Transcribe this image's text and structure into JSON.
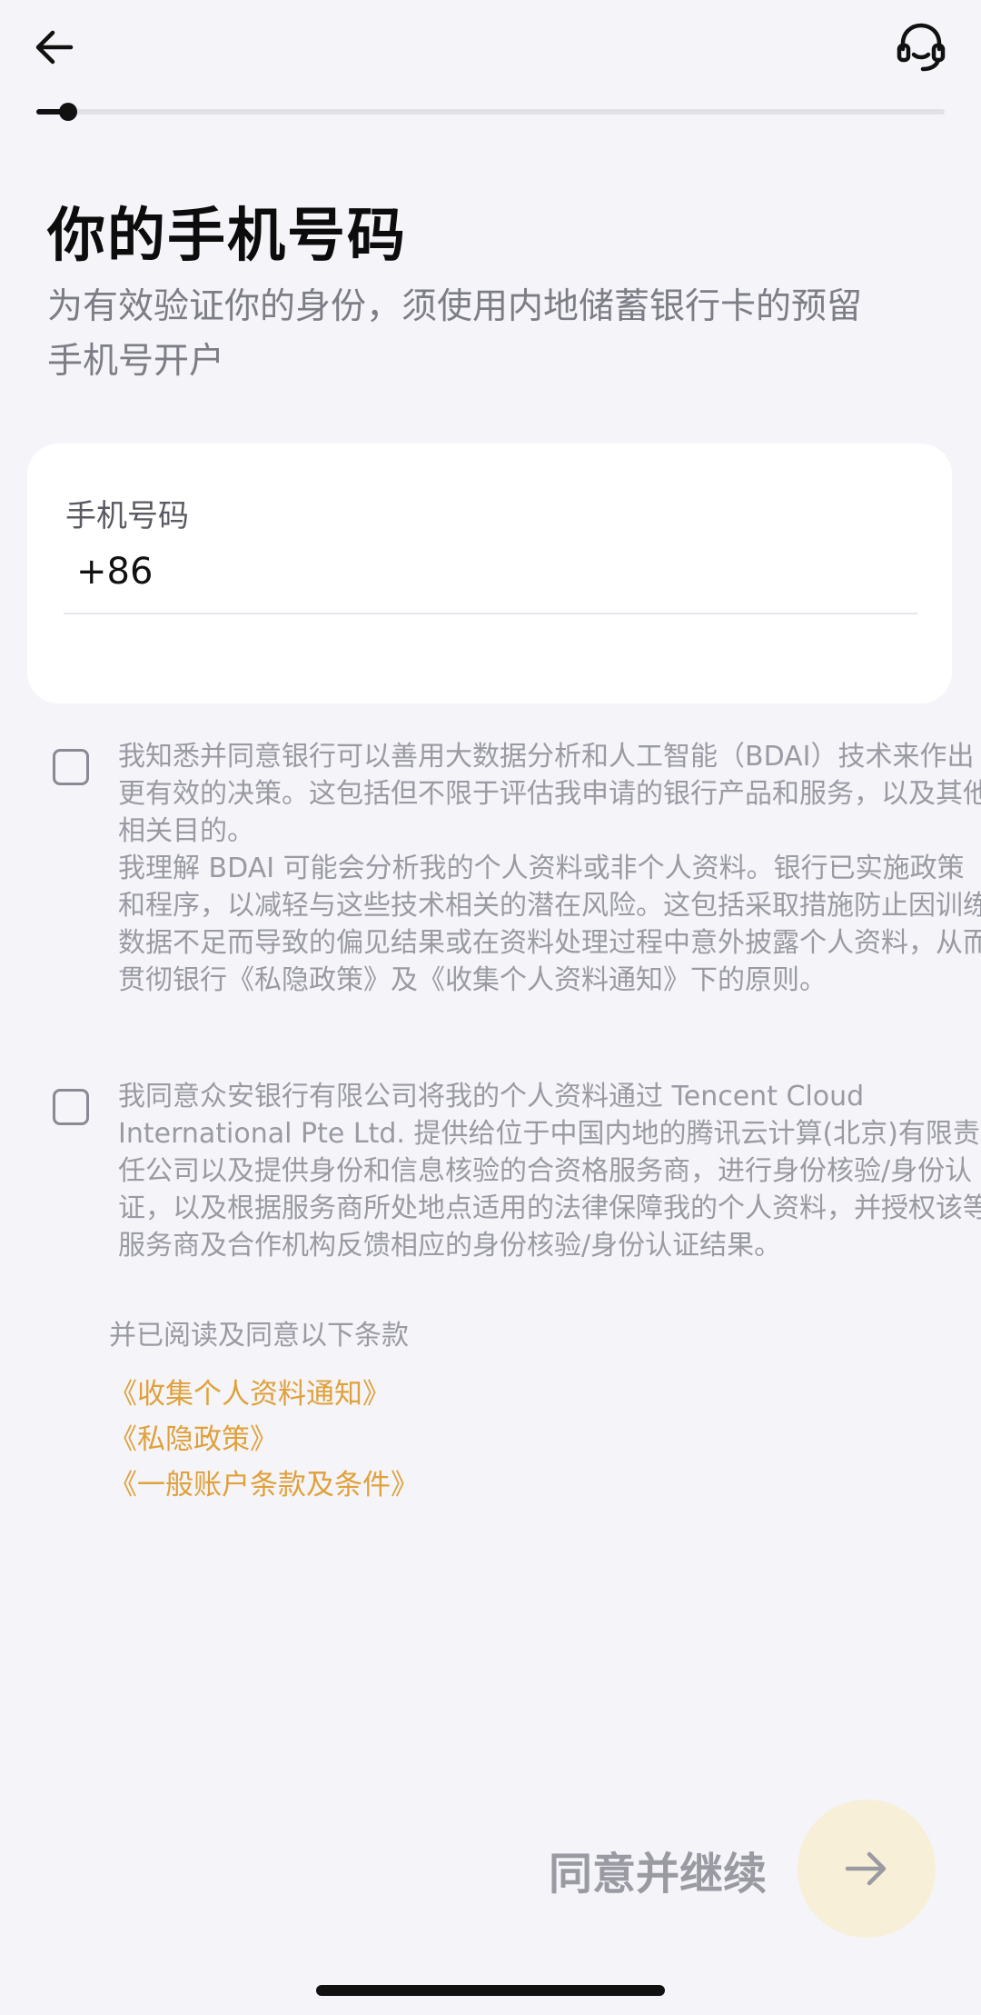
{
  "header": {
    "back_icon": "arrow-left-icon",
    "support_icon": "headset-icon"
  },
  "progress": {
    "fraction": 0.035
  },
  "title": "你的手机号码",
  "subtitle_line1": "为有效验证你的身份，须使用内地储蓄银行卡的预留",
  "subtitle_line2": "手机号开户",
  "phone": {
    "label": "手机号码",
    "country_code": "+86",
    "value": "",
    "placeholder": ""
  },
  "consent_bdai": {
    "checked": false,
    "paragraph1": "我知悉并同意银行可以善用大数据分析和人工智能（BDAI）技术来作出更有效的决策。这包括但不限于评估我申请的银行产品和服务，以及其他相关目的。",
    "paragraph2": "我理解 BDAI 可能会分析我的个人资料或非个人资料。银行已实施政策和程序，以减轻与这些技术相关的潜在风险。这包括采取措施防止因训练数据不足而导致的偏见结果或在资料处理过程中意外披露个人资料，从而贯彻银行《私隐政策》及《收集个人资料通知》下的原则。"
  },
  "consent_tencent": {
    "checked": false,
    "text": "我同意众安银行有限公司将我的个人资料通过 Tencent Cloud International Pte Ltd. 提供给位于中国内地的腾讯云计算(北京)有限责任公司以及提供身份和信息核验的合资格服务商，进行身份核验/身份认证，以及根据服务商所处地点适用的法律保障我的个人资料，并授权该等服务商及合作机构反馈相应的身份核验/身份认证结果。"
  },
  "terms": {
    "intro": "并已阅读及同意以下条款",
    "links": [
      "《收集个人资料通知》",
      "《私隐政策》",
      "《一般账户条款及条件》"
    ]
  },
  "footer": {
    "continue_label": "同意并继续",
    "continue_icon": "arrow-right-icon"
  },
  "colors": {
    "background": "#f4f4f9",
    "card": "#ffffff",
    "link": "#e0a13a",
    "continue_button_bg": "#f7efd7",
    "muted_text": "#9a9aa3"
  }
}
